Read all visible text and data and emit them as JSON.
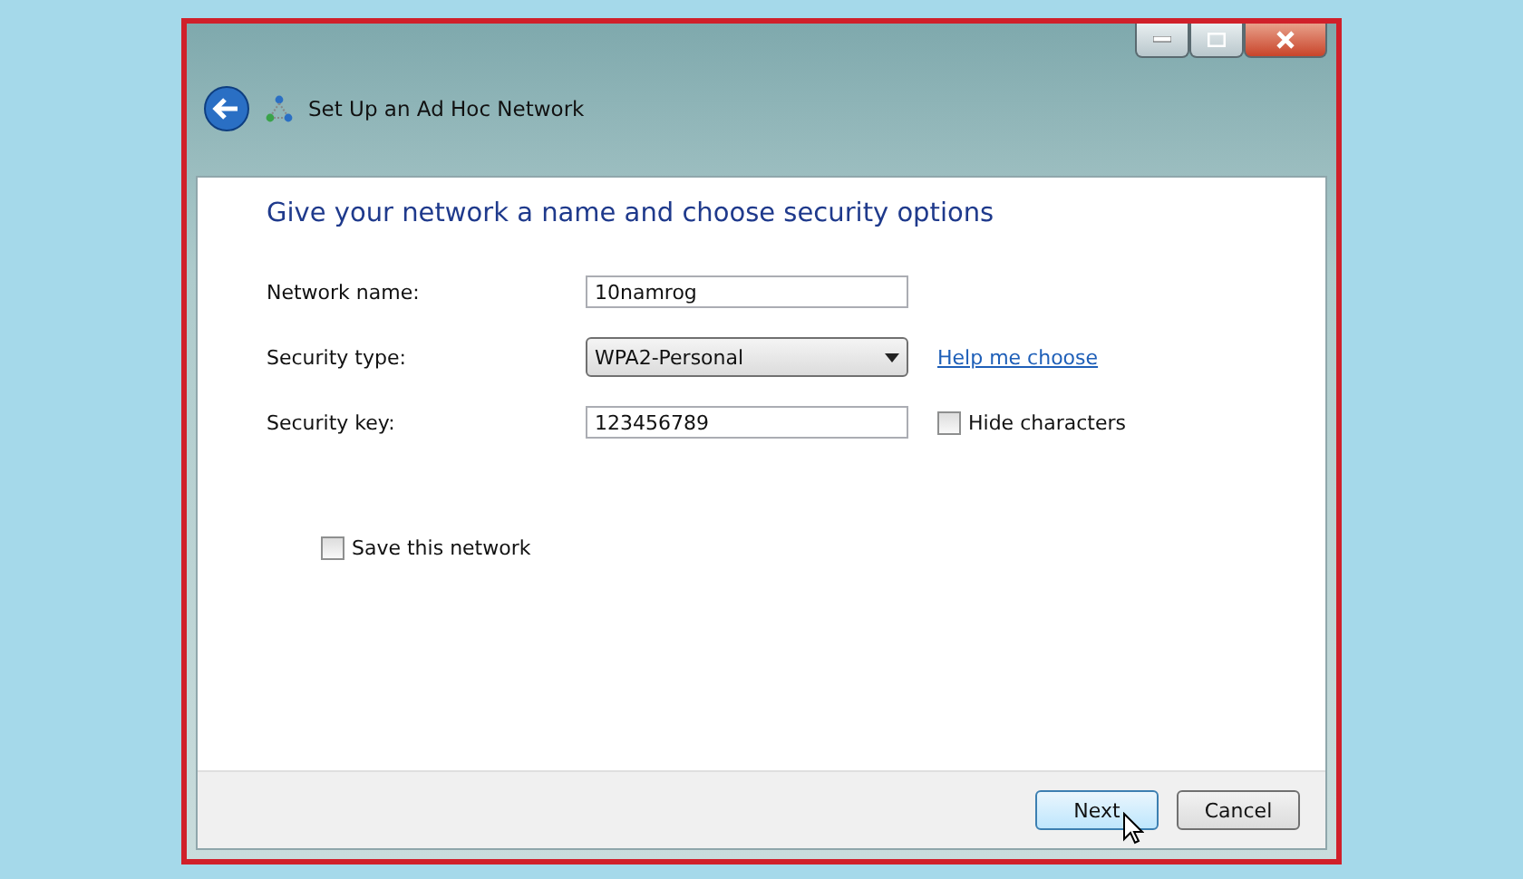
{
  "window": {
    "title": "Set Up an Ad Hoc Network"
  },
  "heading": "Give your network a name and choose security options",
  "fields": [
    {
      "kind": "text",
      "label": "Network name:",
      "value": "10namrog"
    },
    {
      "kind": "select",
      "label": "Security type:",
      "value": "WPA2-Personal",
      "link": "Help me choose"
    },
    {
      "kind": "text",
      "label": "Security key:",
      "value": "123456789",
      "checkbox": {
        "label": "Hide characters",
        "checked": false
      }
    }
  ],
  "save_network": {
    "label": "Save this network",
    "checked": false
  },
  "buttons": [
    {
      "label": "Next",
      "selected": true
    },
    {
      "label": "Cancel",
      "selected": false
    }
  ]
}
